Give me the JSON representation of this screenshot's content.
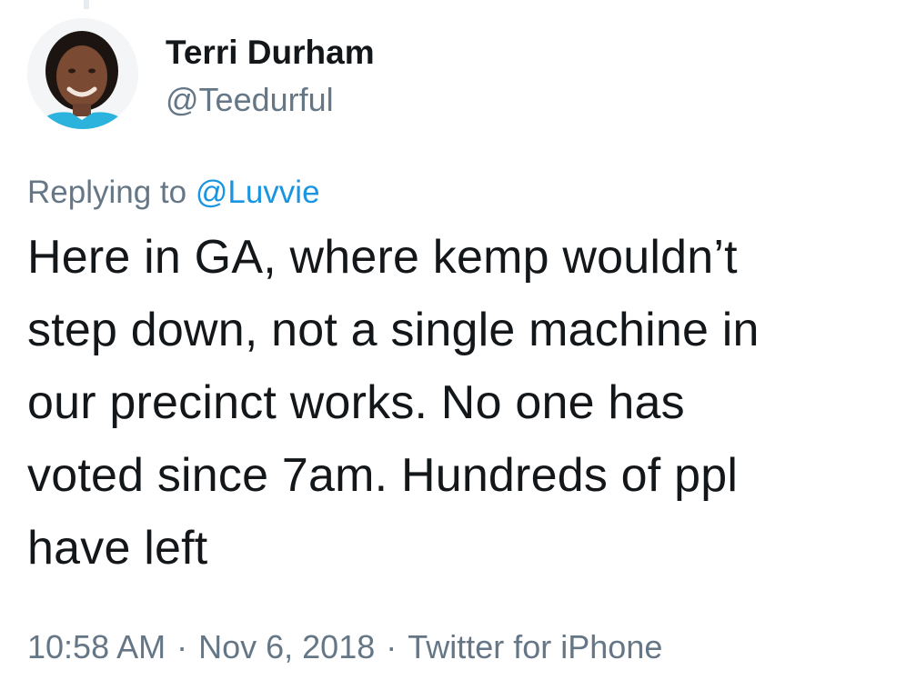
{
  "tweet": {
    "author": {
      "display_name": "Terri Durham",
      "handle": "@Teedurful",
      "avatar_icon": "profile-photo"
    },
    "reply": {
      "prefix": "Replying to",
      "mention": "@Luvvie"
    },
    "body_lines": [
      "Here in GA, where kemp wouldn’t",
      "step down, not a single machine in",
      "our precinct works. No one has",
      "voted since 7am. Hundreds of ppl",
      "have left"
    ],
    "meta": {
      "time": "10:58 AM",
      "date": "Nov 6, 2018",
      "source": "Twitter for iPhone",
      "separator": "·"
    }
  },
  "colors": {
    "text_primary": "#14171a",
    "text_secondary": "#657786",
    "link": "#1b95e0",
    "background": "#ffffff"
  }
}
